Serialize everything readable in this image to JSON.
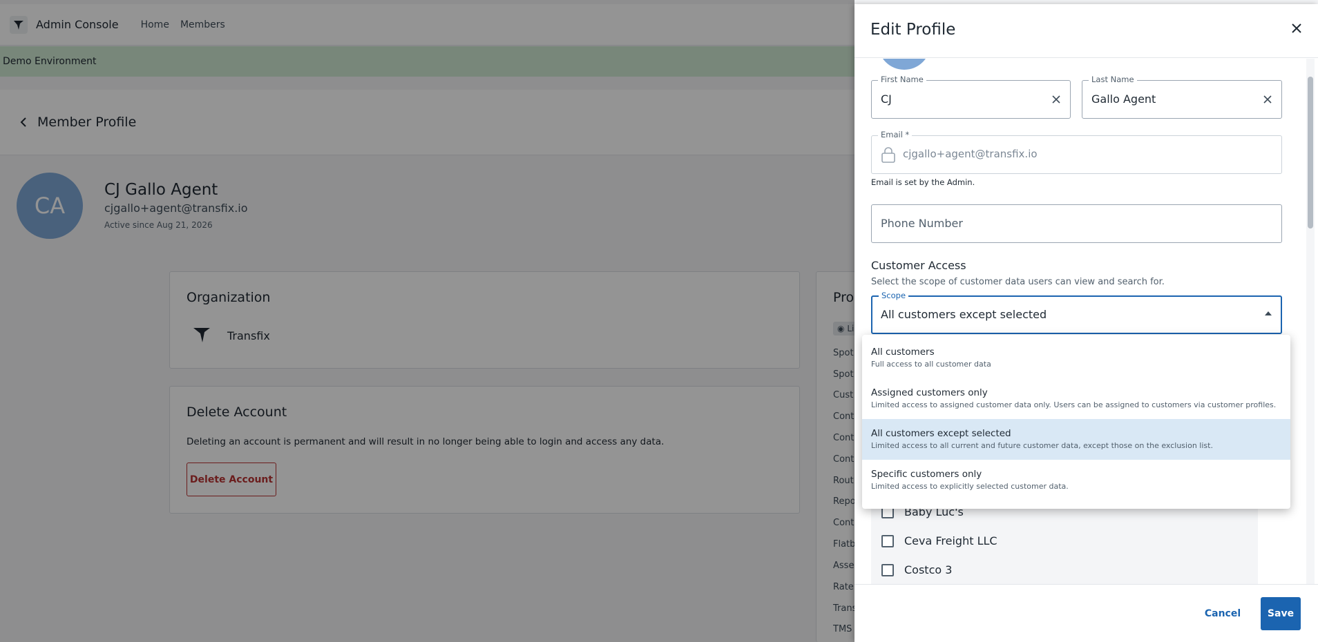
{
  "app": {
    "title": "Admin Console",
    "nav": [
      "Home",
      "Members"
    ]
  },
  "banner": {
    "text": "Demo Environment"
  },
  "header": {
    "title": "Member Profile"
  },
  "member": {
    "initials": "CA",
    "name": "CJ Gallo Agent",
    "email": "cjgallo+agent@transfix.io",
    "active_since": "Active since Aug 21, 2026"
  },
  "organization": {
    "title": "Organization",
    "name": "Transfix"
  },
  "delete_account": {
    "title": "Delete Account",
    "description": "Deleting an account is permanent and will result in no longer being able to login and access any data.",
    "button_label": "Delete Account"
  },
  "permissions": {
    "title_fragment": "Pro",
    "badge": "Li",
    "items": [
      "Spot",
      "Spot",
      "Cust",
      "Cont",
      "Cont",
      "Cont",
      "Rout",
      "Repo",
      "Cont",
      "Flatb",
      "Asse",
      "Rate",
      "Trans",
      "TMS"
    ]
  },
  "drawer": {
    "title": "Edit Profile",
    "first_name": {
      "label": "First Name",
      "value": "CJ"
    },
    "last_name": {
      "label": "Last Name",
      "value": "Gallo Agent"
    },
    "email": {
      "label": "Email *",
      "value": "cjgallo+agent@transfix.io",
      "helper": "Email is set by the Admin."
    },
    "phone": {
      "placeholder": "Phone Number"
    },
    "customer_access": {
      "title": "Customer Access",
      "subtitle": "Select the scope of customer data users can view and search for.",
      "scope_label": "Scope",
      "scope_value": "All customers except selected"
    },
    "customers": [
      "Baby Luc's",
      "Ceva Freight LLC",
      "Costco 3"
    ],
    "cancel_label": "Cancel",
    "save_label": "Save"
  },
  "scope_options": [
    {
      "title": "All customers",
      "description": "Full access to all customer data",
      "selected": false
    },
    {
      "title": "Assigned customers only",
      "description": "Limited access to assigned customer data only. Users can be assigned to customers via customer profiles.",
      "selected": false
    },
    {
      "title": "All customers except selected",
      "description": "Limited access to all current and future customer data, except those on the exclusion list.",
      "selected": true
    },
    {
      "title": "Specific customers only",
      "description": "Limited access to explicitly selected customer data.",
      "selected": false
    }
  ],
  "icons": {
    "logo": "transfix-logo-icon",
    "back": "chevron-left-icon",
    "close": "close-icon",
    "clear": "clear-icon",
    "lock": "lock-icon",
    "caret": "caret-up-icon",
    "eye": "eye-icon"
  },
  "colors": {
    "accent": "#1b64b0",
    "banner": "#cfe9d3",
    "avatar": "#7fa7d6",
    "danger": "#b83232",
    "selected_option": "#d9e8f5"
  }
}
